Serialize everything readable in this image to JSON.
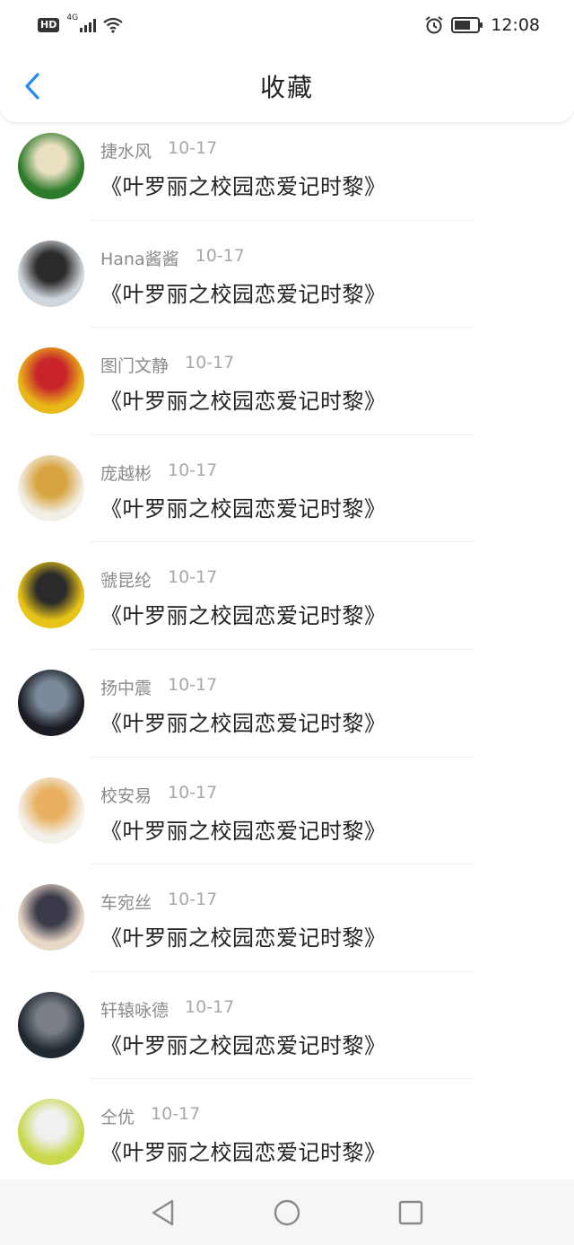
{
  "status_bar": {
    "hd": "HD",
    "network": "4G",
    "time": "12:08"
  },
  "header": {
    "title": "收藏"
  },
  "accent_color": "#2a8bef",
  "items": [
    {
      "name": "捷水风",
      "date": "10-17",
      "title": "《叶罗丽之校园恋爱记时黎》",
      "avatar_colors": [
        "#2d7a2a",
        "#e8e0c0"
      ]
    },
    {
      "name": "Hana酱酱",
      "date": "10-17",
      "title": "《叶罗丽之校园恋爱记时黎》",
      "avatar_colors": [
        "#cfd6dc",
        "#2c2a2a"
      ]
    },
    {
      "name": "图门文静",
      "date": "10-17",
      "title": "《叶罗丽之校园恋爱记时黎》",
      "avatar_colors": [
        "#e8b818",
        "#c8242a"
      ]
    },
    {
      "name": "庞越彬",
      "date": "10-17",
      "title": "《叶罗丽之校园恋爱记时黎》",
      "avatar_colors": [
        "#f2efe6",
        "#d8a440"
      ]
    },
    {
      "name": "虢昆纶",
      "date": "10-17",
      "title": "《叶罗丽之校园恋爱记时黎》",
      "avatar_colors": [
        "#e8c418",
        "#2a2a2a"
      ]
    },
    {
      "name": "扬中震",
      "date": "10-17",
      "title": "《叶罗丽之校园恋爱记时黎》",
      "avatar_colors": [
        "#1a1c22",
        "#7a8a9a"
      ]
    },
    {
      "name": "校安易",
      "date": "10-17",
      "title": "《叶罗丽之校园恋爱记时黎》",
      "avatar_colors": [
        "#f4f0ea",
        "#e8b060"
      ]
    },
    {
      "name": "车宛丝",
      "date": "10-17",
      "title": "《叶罗丽之校园恋爱记时黎》",
      "avatar_colors": [
        "#e8d8c8",
        "#3a3a4a"
      ]
    },
    {
      "name": "轩辕咏德",
      "date": "10-17",
      "title": "《叶罗丽之校园恋爱记时黎》",
      "avatar_colors": [
        "#202830",
        "#7a7f86"
      ]
    },
    {
      "name": "仝优",
      "date": "10-17",
      "title": "《叶罗丽之校园恋爱记时黎》",
      "avatar_colors": [
        "#c8d84a",
        "#f0f0f0"
      ]
    }
  ]
}
